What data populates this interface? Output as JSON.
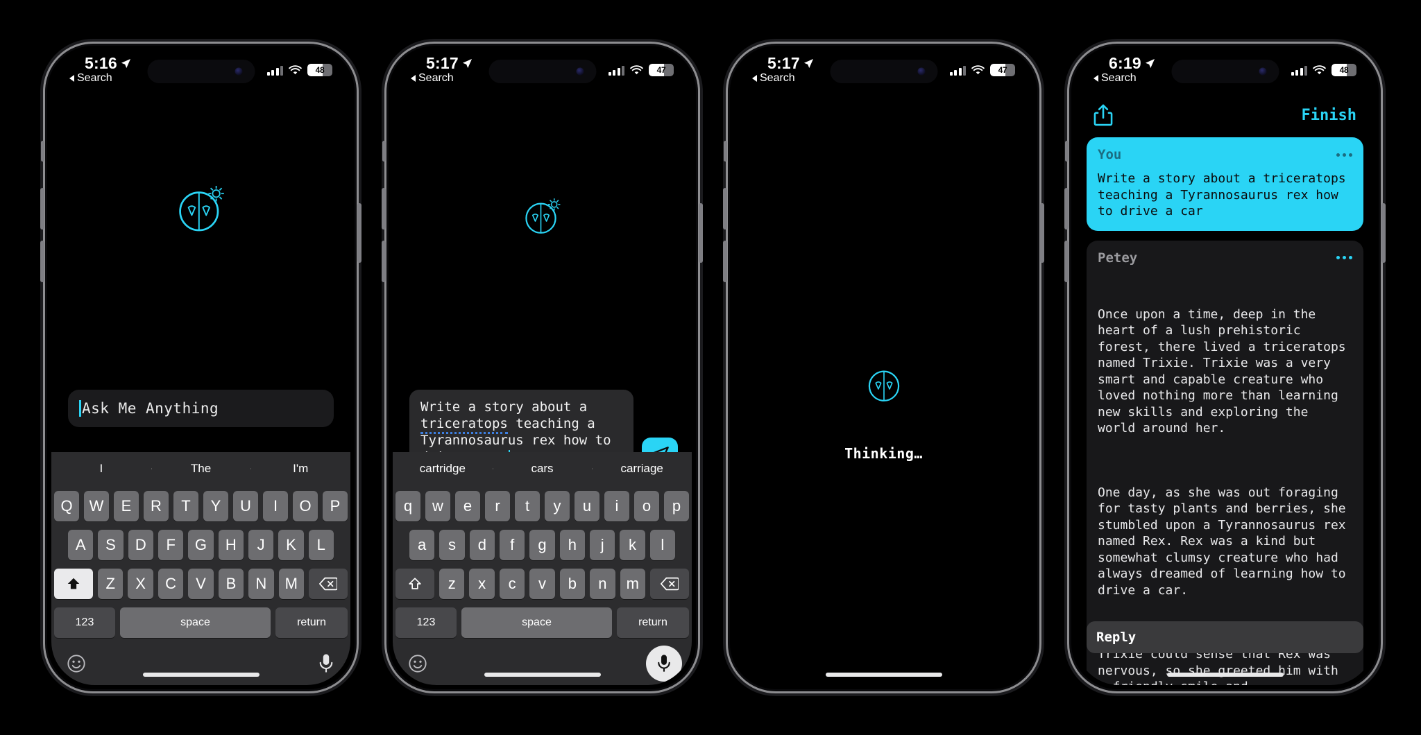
{
  "app": {
    "name": "Petey",
    "accent": "#2ad4f5",
    "background": "#000000"
  },
  "phones": [
    {
      "id": "phone-1",
      "status": {
        "time": "5:16",
        "back_label": "Search",
        "battery": "48",
        "battery_pct": 48,
        "wifi": "wifi-icon",
        "cellular": "signal-bars-icon",
        "location": "location-arrow-icon"
      },
      "input": {
        "placeholder": "Ask Me Anything",
        "value": ""
      },
      "predictive": [
        "I",
        "The",
        "I'm"
      ],
      "keyboard": {
        "row1": [
          "Q",
          "W",
          "E",
          "R",
          "T",
          "Y",
          "U",
          "I",
          "O",
          "P"
        ],
        "row2": [
          "A",
          "S",
          "D",
          "F",
          "G",
          "H",
          "J",
          "K",
          "L"
        ],
        "row3": [
          "Z",
          "X",
          "C",
          "V",
          "B",
          "N",
          "M"
        ],
        "shift_label": "shift-key",
        "delete_label": "delete-key",
        "numbers_label": "123",
        "space_label": "space",
        "return_label": "return",
        "emoji_label": "emoji-key",
        "mic_label": "dictation-key",
        "shift_active": true
      }
    },
    {
      "id": "phone-2",
      "status": {
        "time": "5:17",
        "back_label": "Search",
        "battery": "47",
        "battery_pct": 47
      },
      "compose": {
        "lines": [
          "Write a story about a ",
          "triceratops| teaching a",
          "Tyrannosaurus rex how to",
          "drive a car"
        ],
        "line1": "Write a story about a",
        "line2_misspelled": "triceratops",
        "line2_rest": " teaching a",
        "line3": "Tyrannosaurus rex how to",
        "line4": "drive a car",
        "send_label": "send-button"
      },
      "predictive": [
        "cartridge",
        "cars",
        "carriage"
      ],
      "keyboard": {
        "row1": [
          "q",
          "w",
          "e",
          "r",
          "t",
          "y",
          "u",
          "i",
          "o",
          "p"
        ],
        "row2": [
          "a",
          "s",
          "d",
          "f",
          "g",
          "h",
          "j",
          "k",
          "l"
        ],
        "row3": [
          "z",
          "x",
          "c",
          "v",
          "b",
          "n",
          "m"
        ],
        "numbers_label": "123",
        "space_label": "space",
        "return_label": "return",
        "shift_active": false
      }
    },
    {
      "id": "phone-3",
      "status": {
        "time": "5:17",
        "back_label": "Search",
        "battery": "47",
        "battery_pct": 47
      },
      "thinking_label": "Thinking…"
    },
    {
      "id": "phone-4",
      "status": {
        "time": "6:19",
        "back_label": "Search",
        "battery": "48",
        "battery_pct": 48
      },
      "toolbar": {
        "share_label": "share-icon",
        "finish_label": "Finish"
      },
      "messages": [
        {
          "author": "You",
          "role": "user",
          "text": "Write a story about a triceratops teaching a Tyrannosaurus rex how to drive a car",
          "menu_label": "message-options"
        },
        {
          "author": "Petey",
          "role": "assistant",
          "paragraphs": [
            "Once upon a time, deep in the heart of a lush prehistoric forest, there lived a triceratops named Trixie. Trixie was a very smart and capable creature who loved nothing more than learning new skills and exploring the world around her.",
            "One day, as she was out foraging for tasty plants and berries, she stumbled upon a Tyrannosaurus rex named Rex. Rex was a kind but somewhat clumsy creature who had always dreamed of learning how to drive a car.",
            "Trixie could sense that Rex was nervous, so she greeted him with a friendly smile and"
          ],
          "menu_label": "message-options"
        }
      ],
      "reply": {
        "label": "Reply"
      }
    }
  ]
}
